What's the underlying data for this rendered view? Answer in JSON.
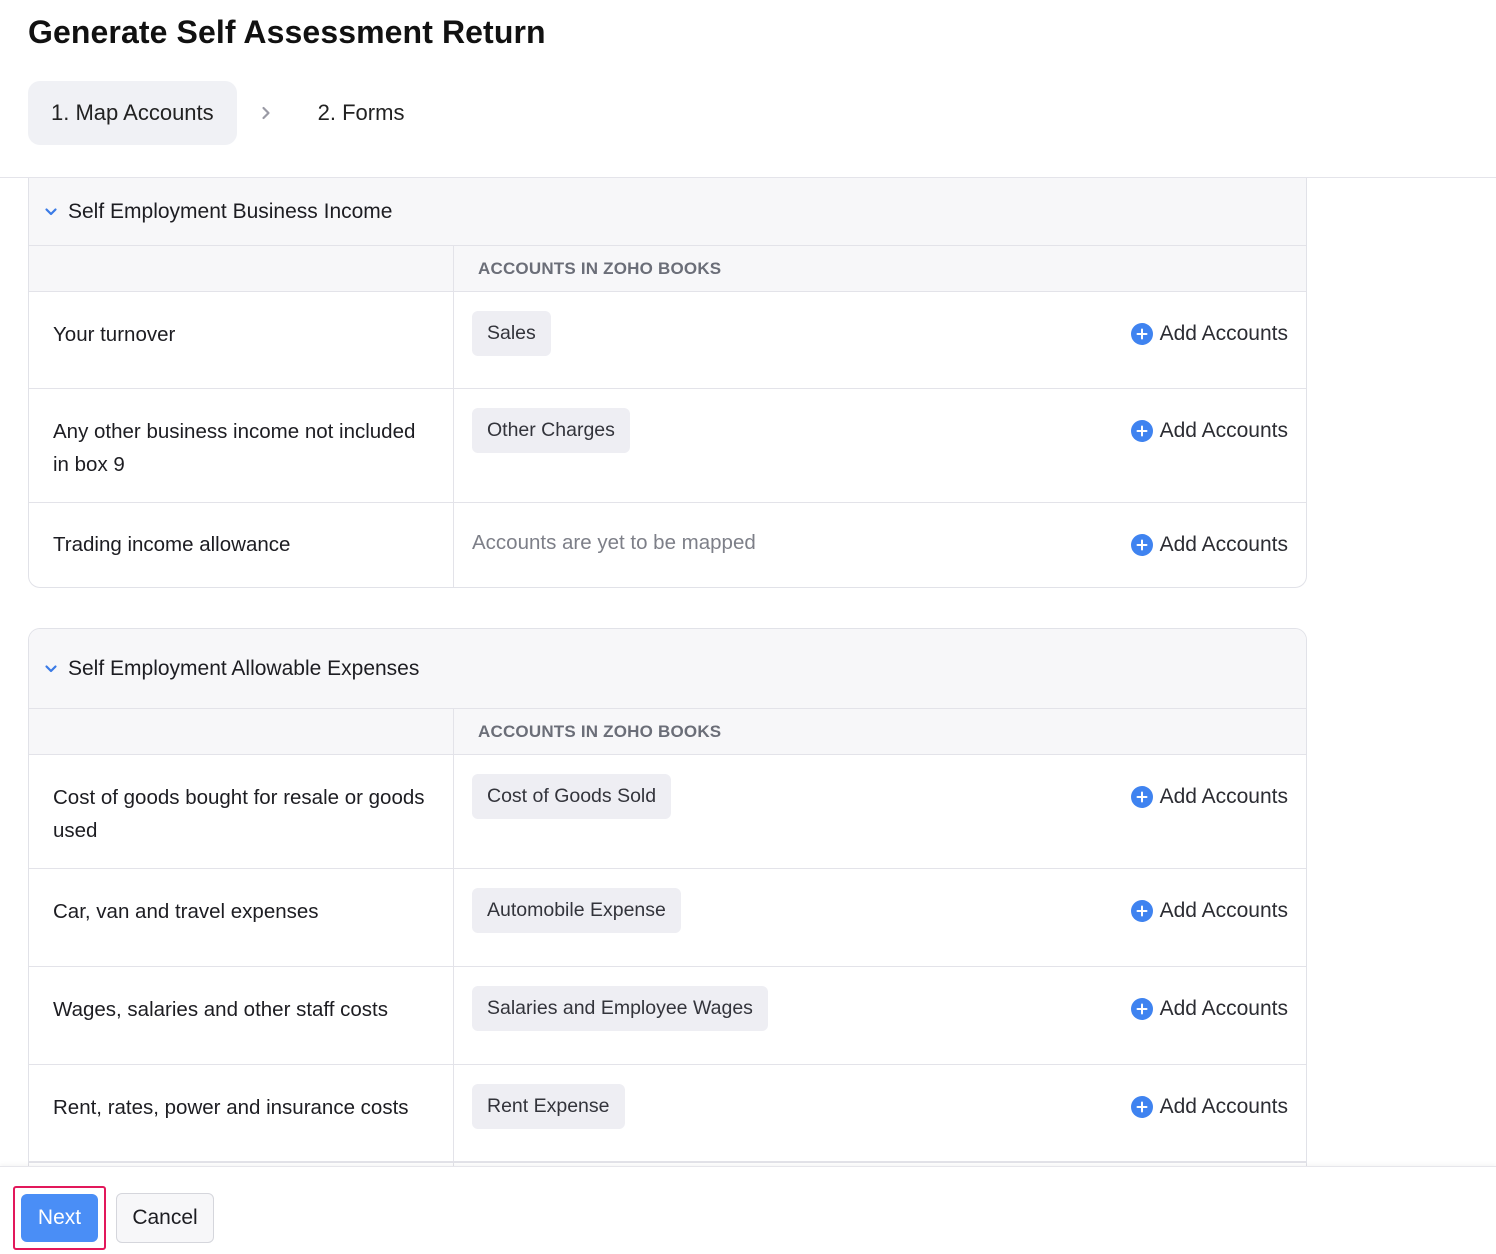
{
  "page": {
    "title": "Generate Self Assessment Return"
  },
  "steps": [
    {
      "label": "1. Map Accounts",
      "active": true
    },
    {
      "label": "2. Forms",
      "active": false
    }
  ],
  "sections": [
    {
      "title": "Self Employment Business Income",
      "column_header": "ACCOUNTS IN ZOHO BOOKS",
      "rows": [
        {
          "label": "Your turnover",
          "account": "Sales",
          "action": "Add Accounts"
        },
        {
          "label": "Any other business income not included in box 9",
          "account": "Other Charges",
          "action": "Add Accounts"
        },
        {
          "label": "Trading income allowance",
          "placeholder": "Accounts are yet to be mapped",
          "action": "Add Accounts"
        }
      ]
    },
    {
      "title": "Self Employment Allowable Expenses",
      "column_header": "ACCOUNTS IN ZOHO BOOKS",
      "rows": [
        {
          "label": "Cost of goods bought for resale or goods used",
          "account": "Cost of Goods Sold",
          "action": "Add Accounts"
        },
        {
          "label": "Car, van and travel expenses",
          "account": "Automobile Expense",
          "action": "Add Accounts"
        },
        {
          "label": "Wages, salaries and other staff costs",
          "account": "Salaries and Employee Wages",
          "action": "Add Accounts"
        },
        {
          "label": "Rent, rates, power and insurance costs",
          "account": "Rent Expense",
          "action": "Add Accounts"
        }
      ]
    }
  ],
  "footer": {
    "next_label": "Next",
    "cancel_label": "Cancel"
  },
  "colors": {
    "accent": "#4a8ef6",
    "highlight_border": "#e2185b",
    "plus_icon": "#3f83f0"
  }
}
